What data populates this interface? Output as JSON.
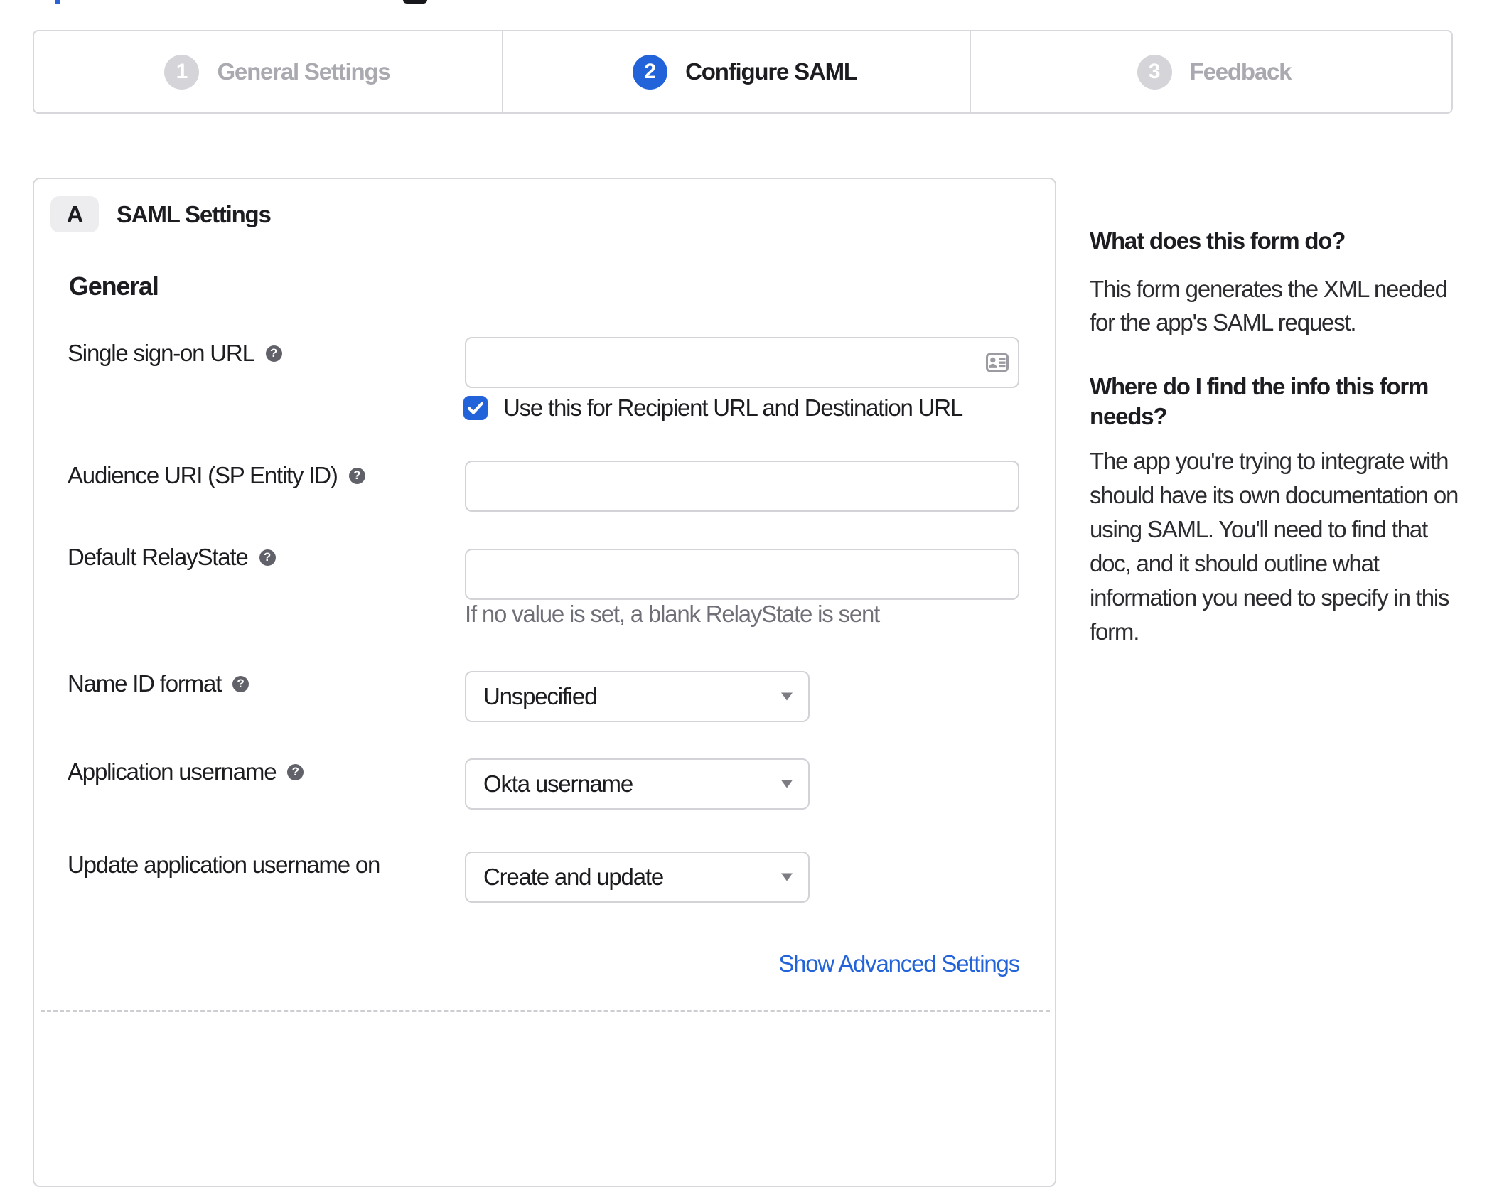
{
  "colors": {
    "accent": "#2263d9",
    "link": "#2363da",
    "text": "#1d1d21",
    "muted_text": "#6f6f78",
    "step_inactive_text": "#a9a9b0",
    "step_inactive_circle": "#d4d4d9",
    "border": "#d7d7dc",
    "control_border": "#d2d2d7",
    "badge_bg": "#ededf0",
    "help_icon_bg": "#61616a",
    "icon_gray": "#9b9ba1"
  },
  "steps": [
    {
      "number": "1",
      "label": "General Settings",
      "state": "inactive"
    },
    {
      "number": "2",
      "label": "Configure SAML",
      "state": "active"
    },
    {
      "number": "3",
      "label": "Feedback",
      "state": "inactive"
    }
  ],
  "panel": {
    "section_letter": "A",
    "section_title": "SAML Settings",
    "group_heading": "General",
    "fields": {
      "sso": {
        "label": "Single sign-on URL",
        "value": "",
        "checkbox_label": "Use this for Recipient URL and Destination URL",
        "checkbox_checked": true
      },
      "audience": {
        "label": "Audience URI (SP Entity ID)",
        "value": ""
      },
      "relay": {
        "label": "Default RelayState",
        "value": "",
        "helper": "If no value is set, a blank RelayState is sent"
      },
      "nameid": {
        "label": "Name ID format",
        "value": "Unspecified"
      },
      "appuser": {
        "label": "Application username",
        "value": "Okta username"
      },
      "update": {
        "label": "Update application username on",
        "value": "Create and update"
      }
    },
    "advanced_link": "Show Advanced Settings"
  },
  "sidebar": {
    "q1": "What does this form do?",
    "a1_lines": [
      "This form generates the XML needed",
      "for the app's SAML request."
    ],
    "q2_lines": [
      "Where do I find the info this form",
      "needs?"
    ],
    "a2_lines": [
      "The app you're trying to integrate with",
      "should have its own documentation on",
      "using SAML. You'll need to find that",
      "doc, and it should outline what",
      "information you need to specify in this",
      "form."
    ]
  },
  "icons": {
    "help_glyph": "?"
  }
}
